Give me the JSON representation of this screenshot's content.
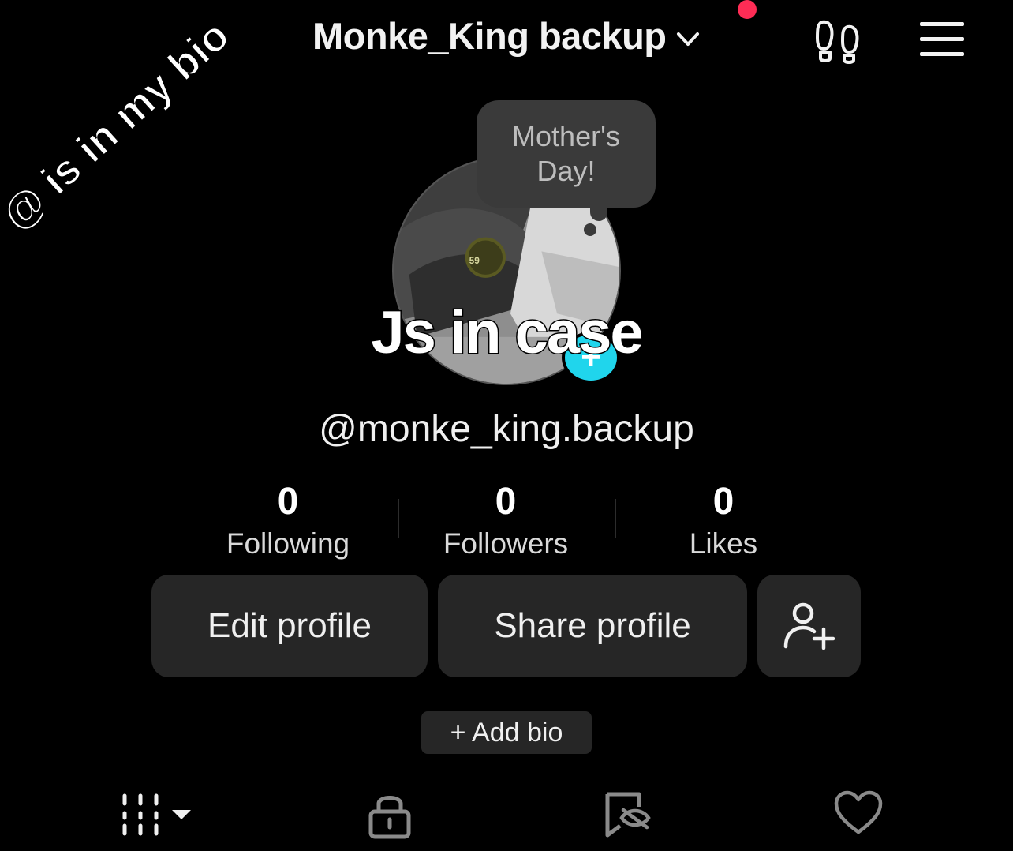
{
  "header": {
    "title": "Monke_King backup",
    "has_notification": true,
    "accent_color": "#fe2c55",
    "icons": [
      "chevron-down-icon",
      "footprints-icon",
      "hamburger-menu-icon"
    ]
  },
  "overlay": {
    "diagonal_text": "@ is in my bio",
    "caption": "Js in case"
  },
  "profile": {
    "avatar_note": "Mother's Day!",
    "username": "@monke_king.backup",
    "avatar_add_color": "#20d5ec"
  },
  "stats": [
    {
      "value": "0",
      "label": "Following"
    },
    {
      "value": "0",
      "label": "Followers"
    },
    {
      "value": "0",
      "label": "Likes"
    }
  ],
  "actions": {
    "edit_profile": "Edit profile",
    "share_profile": "Share profile",
    "add_bio": "+ Add bio"
  },
  "tabs": [
    {
      "icon": "grid-videos-icon"
    },
    {
      "icon": "lock-icon"
    },
    {
      "icon": "hidden-bookmark-icon"
    },
    {
      "icon": "heart-icon"
    }
  ]
}
